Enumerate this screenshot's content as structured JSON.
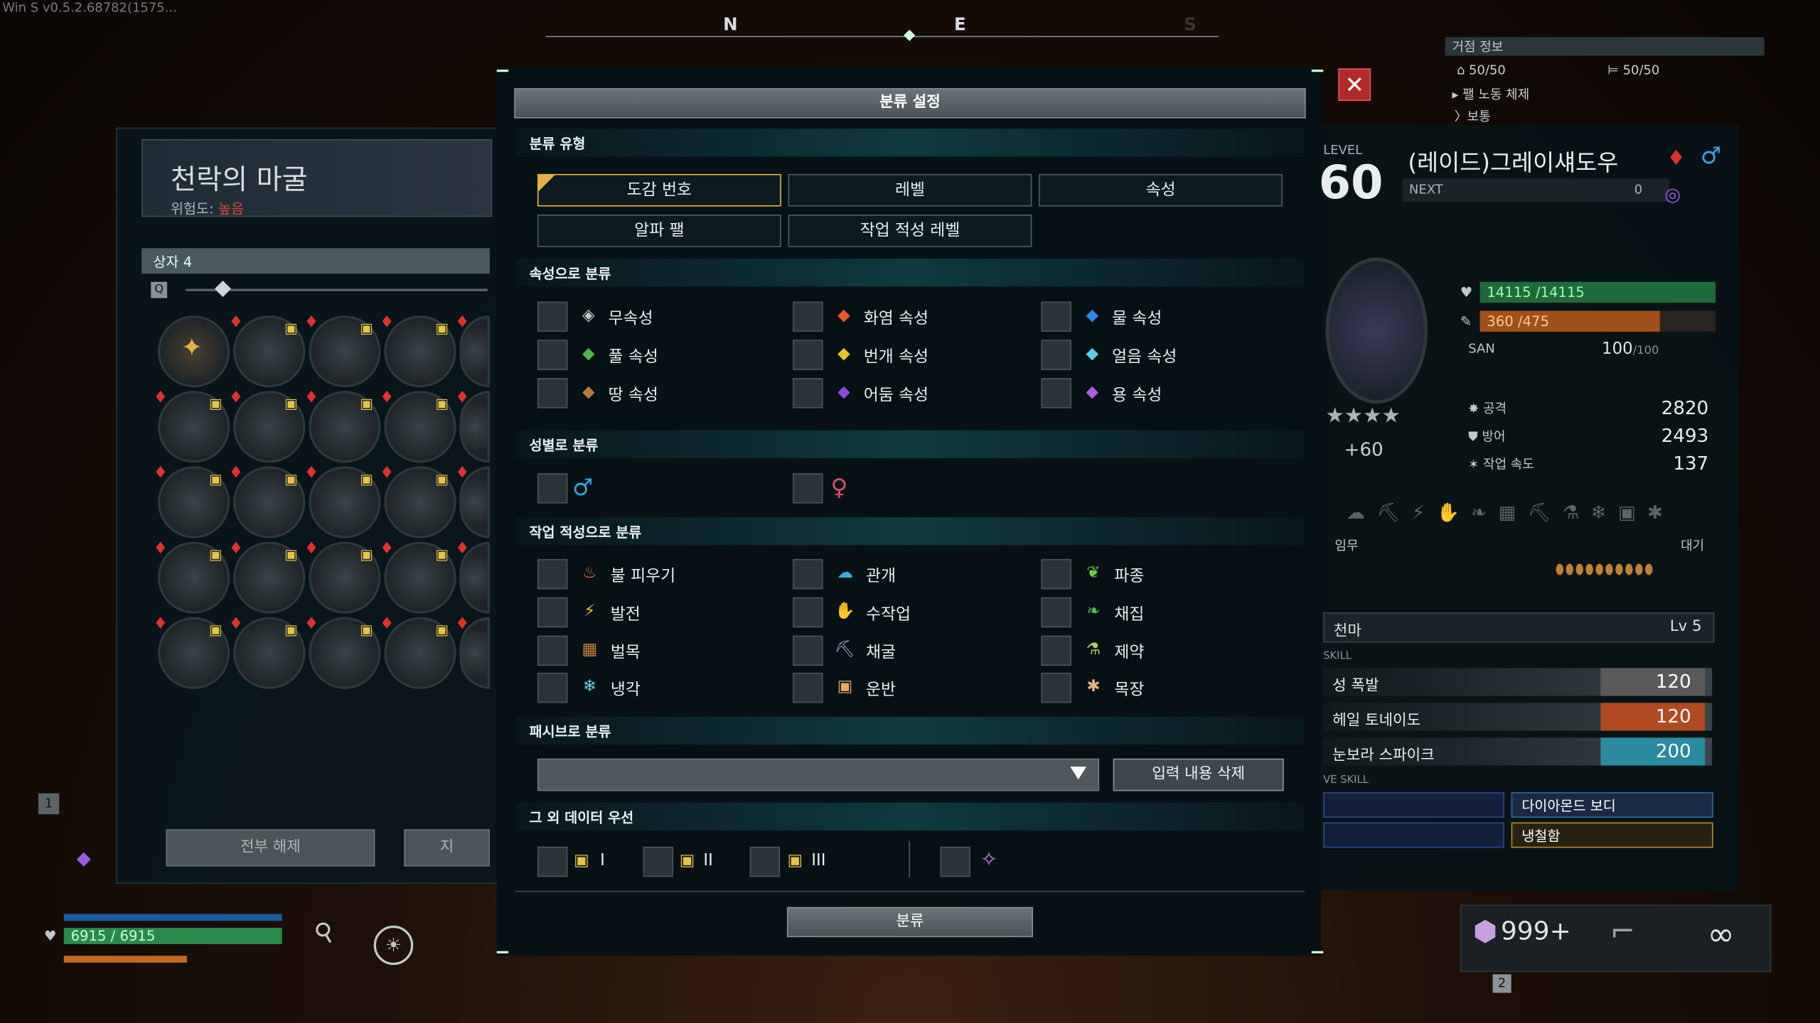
{
  "version": "Win S v0.5.2.68782(1575...",
  "compass": {
    "n": "N",
    "e": "E",
    "s": "S"
  },
  "left": {
    "area_name": "천락의 마굴",
    "risk_label": "위험도:",
    "risk_value": "높음",
    "box_label": "상자 4",
    "release_all": "전부 해제",
    "cut_button": "지",
    "hp_text": "6915 / 6915",
    "hotkey": "1"
  },
  "dialog": {
    "title": "분류 설정",
    "sort_type_header": "분류 유형",
    "sort_types": [
      "도감 번호",
      "레벨",
      "속성",
      "알파 팰",
      "작업 적성 레벨"
    ],
    "selected_type": "도감 번호",
    "element_header": "속성으로 분류",
    "elements": [
      {
        "label": "무속성",
        "icon": "neutral-icon",
        "color": "#c8c8c8"
      },
      {
        "label": "화염 속성",
        "icon": "fire-icon",
        "color": "#e85a2a"
      },
      {
        "label": "물 속성",
        "icon": "water-icon",
        "color": "#2a8ae8"
      },
      {
        "label": "풀 속성",
        "icon": "grass-icon",
        "color": "#4ab84a"
      },
      {
        "label": "번개 속성",
        "icon": "electric-icon",
        "color": "#e8c42a"
      },
      {
        "label": "얼음 속성",
        "icon": "ice-icon",
        "color": "#5ad0e8"
      },
      {
        "label": "땅 속성",
        "icon": "ground-icon",
        "color": "#b87a3a"
      },
      {
        "label": "어둠 속성",
        "icon": "dark-icon",
        "color": "#8a4ae0"
      },
      {
        "label": "용 속성",
        "icon": "dragon-icon",
        "color": "#b05ae0"
      }
    ],
    "gender_header": "성별로 분류",
    "gender_male": "♂",
    "gender_female": "♀",
    "work_header": "작업 적성으로 분류",
    "works": [
      {
        "label": "불 피우기",
        "icon": "kindling-icon",
        "glyph": "♨",
        "color": "#e86a3a"
      },
      {
        "label": "관개",
        "icon": "watering-icon",
        "glyph": "☁",
        "color": "#3ab0e0"
      },
      {
        "label": "파종",
        "icon": "planting-icon",
        "glyph": "❦",
        "color": "#6ad04a"
      },
      {
        "label": "발전",
        "icon": "generating-icon",
        "glyph": "⚡",
        "color": "#e8c42a"
      },
      {
        "label": "수작업",
        "icon": "handiwork-icon",
        "glyph": "✋",
        "color": "#e8d8b0"
      },
      {
        "label": "채집",
        "icon": "gathering-icon",
        "glyph": "❧",
        "color": "#4ac05a"
      },
      {
        "label": "벌목",
        "icon": "lumbering-icon",
        "glyph": "▦",
        "color": "#c8803a"
      },
      {
        "label": "채굴",
        "icon": "mining-icon",
        "glyph": "⛏",
        "color": "#9ab0e0"
      },
      {
        "label": "제약",
        "icon": "medicine-icon",
        "glyph": "⚗",
        "color": "#a8d060"
      },
      {
        "label": "냉각",
        "icon": "cooling-icon",
        "glyph": "❄",
        "color": "#6ad0f0"
      },
      {
        "label": "운반",
        "icon": "transporting-icon",
        "glyph": "▣",
        "color": "#e8a860"
      },
      {
        "label": "목장",
        "icon": "farming-icon",
        "glyph": "✱",
        "color": "#e8b080"
      }
    ],
    "passive_header": "패시브로 분류",
    "clear_input": "입력 내용 삭제",
    "other_header": "그 외 데이터 우선",
    "locks": [
      "I",
      "II",
      "III"
    ],
    "sort_button": "분류"
  },
  "right": {
    "base_info": "거점 정보",
    "base_pals": "50/50",
    "base_beds": "50/50",
    "pal_work": "팰 노동 체제",
    "pal_work_mode": "보통",
    "level_label": "LEVEL",
    "level": "60",
    "pal_name": "(레이드)그레이섀도우",
    "next_label": "NEXT",
    "next_value": "0",
    "hp": "14115 /14115",
    "hunger": "360 /475",
    "san_label": "SAN",
    "san_value": "100",
    "san_max": "/100",
    "bonus": "+60",
    "attack_label": "공격",
    "attack": "2820",
    "defense_label": "방어",
    "defense": "2493",
    "work_speed_label": "작업 속도",
    "work_speed": "137",
    "task_label": "임무",
    "task_value": "대기",
    "partner_skill": "천마",
    "partner_lv": "Lv 5",
    "active_skill_label": "SKILL",
    "skills": [
      {
        "name": "성 폭발",
        "value": "120",
        "color": "#6a6a6a"
      },
      {
        "name": "헤일 토네이도",
        "value": "120",
        "color": "#c04a20"
      },
      {
        "name": "눈보라 스파이크",
        "value": "200",
        "color": "#2a9ab0"
      }
    ],
    "passive_label": "VE SKILL",
    "passives": [
      "다이아몬드 보디",
      "냉철함"
    ],
    "count": "999+",
    "hotkey2": "2"
  }
}
